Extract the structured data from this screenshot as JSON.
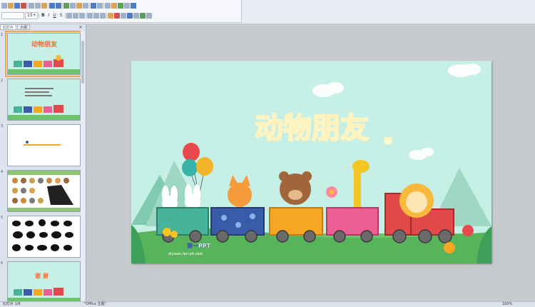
{
  "toolbar": {
    "font_size": "15+",
    "bold_label": "B",
    "italic_label": "I",
    "underline_label": "U",
    "strike_label": "S"
  },
  "left_pane": {
    "tabs": [
      "幻灯片",
      "大纲"
    ],
    "close": "×",
    "slide_numbers": [
      "1",
      "2",
      "3",
      "4",
      "5",
      "6"
    ]
  },
  "slide": {
    "title": "动物朋友",
    "watermark_line1": "第一PPT",
    "watermark_line2": "diyiaan.fan-plt.com",
    "colors": {
      "background": "#c6efe6",
      "title": "#ff6a2b",
      "title_stroke": "#fff3c0",
      "grass": "#6cc46a"
    }
  },
  "thumbs": {
    "t1_title": "动物朋友",
    "t6_title": "谢 谢"
  },
  "status": {
    "left": "幻灯片 1/6",
    "theme": "\"Office 主题\"",
    "zoom": "100%"
  }
}
